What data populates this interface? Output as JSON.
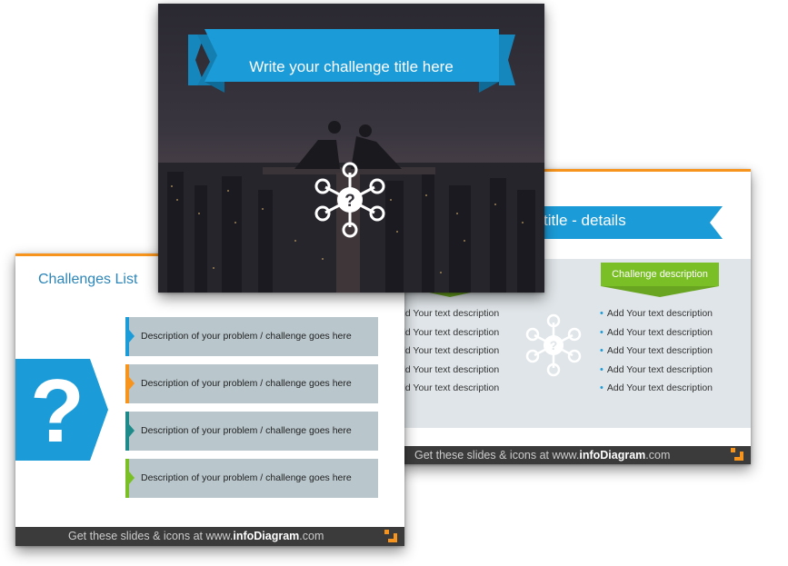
{
  "slide_right": {
    "title_fragment": "title - details",
    "green_label": "Challenge description",
    "left_items": [
      "dd Your text description",
      "dd Your text description",
      "dd Your text description",
      "dd Your text description",
      "dd Your text description"
    ],
    "right_items": [
      "Add Your text description",
      "Add Your text description",
      "Add Your text description",
      "Add Your text description",
      "Add Your text description"
    ],
    "footer_prefix": "Get these slides & icons at www.",
    "footer_brand": "infoDiagram",
    "footer_suffix": ".com"
  },
  "slide_left": {
    "title": "Challenges List",
    "question_mark": "?",
    "rows": [
      {
        "text": "Description of your problem / challenge goes here",
        "color": "#1b9bd7"
      },
      {
        "text": "Description of your problem / challenge goes here",
        "color": "#f7941d"
      },
      {
        "text": "Description of your problem / challenge goes here",
        "color": "#1f8a8a"
      },
      {
        "text": "Description of your problem / challenge goes here",
        "color": "#7bbf27"
      }
    ],
    "footer_prefix": "Get these slides & icons at www.",
    "footer_brand": "infoDiagram",
    "footer_suffix": ".com"
  },
  "slide_top": {
    "title": "Write your challenge title here"
  },
  "colors": {
    "accent_blue": "#1b9bd7",
    "accent_orange": "#f7941d",
    "accent_green": "#7bbf27",
    "footer_gray": "#3b3b3b"
  },
  "icons": [
    "network-question-icon",
    "question-mark-icon",
    "corner-logo-icon"
  ]
}
